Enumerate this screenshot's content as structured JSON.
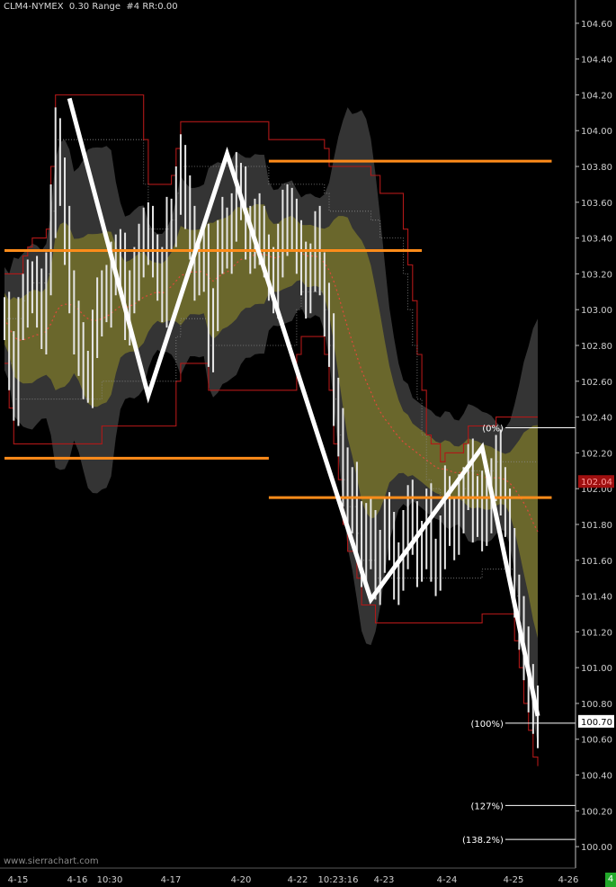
{
  "header": {
    "symbol": "CLM4-NYMEX",
    "bar_period": "0.30 Range",
    "chart_number": "#4",
    "rr": "RR:0.00"
  },
  "watermark": "www.sierrachart.com",
  "corner_badge": "4",
  "colors": {
    "background": "#000000",
    "price_bar": "#e6e6e6",
    "channel_outer": "#b01818",
    "band_outer": "#3a3a3a",
    "band_inner": "#6e6a2c",
    "level_line": "#ff8c1a",
    "zigzag": "#ffffff",
    "last_price_bg": "#ffffff",
    "avg_label_bg": "#a01010"
  },
  "chart_data": {
    "type": "line",
    "y_axis": {
      "ylim": [
        99.88,
        104.73
      ],
      "ticks": [
        "104.60",
        "104.40",
        "104.20",
        "104.00",
        "103.80",
        "103.60",
        "103.40",
        "103.20",
        "103.00",
        "102.80",
        "102.60",
        "102.40",
        "102.20",
        "102.00",
        "101.80",
        "101.60",
        "101.40",
        "101.20",
        "101.00",
        "100.80",
        "100.60",
        "100.40",
        "100.20",
        "100.00"
      ]
    },
    "x_axis": {
      "tick_labels": [
        "4-15",
        "4-16",
        "10:30",
        "4-17",
        "4-20",
        "4-22",
        "10:23:16",
        "4-23",
        "4-24",
        "4-25",
        "4-26"
      ]
    },
    "last_price": "100.70",
    "avg_label": "102.04",
    "levels": [
      {
        "y": 103.83,
        "x0": 57,
        "x1": 118
      },
      {
        "y": 103.33,
        "x0": 0,
        "x1": 90
      },
      {
        "y": 102.17,
        "x0": 0,
        "x1": 57
      },
      {
        "y": 101.95,
        "x0": 57,
        "x1": 118
      }
    ],
    "zigzag": {
      "points": [
        [
          14,
          104.18
        ],
        [
          31,
          102.52
        ],
        [
          48,
          103.87
        ],
        [
          79,
          101.38
        ],
        [
          103,
          102.23
        ],
        [
          115,
          100.73
        ]
      ],
      "fib_labels": [
        {
          "label": "(0%)",
          "value": 102.34
        },
        {
          "label": "(100%)",
          "value": 100.69
        },
        {
          "label": "(127%)",
          "value": 100.23
        },
        {
          "label": "(138.2%)",
          "value": 100.04
        }
      ]
    },
    "series": [
      {
        "values": [
          102.95,
          102.7,
          102.5,
          102.95,
          103.05,
          103.1,
          103.15,
          103.05,
          102.9,
          103.2,
          103.55,
          103.95,
          103.7,
          103.4,
          103.1,
          102.9,
          102.75,
          102.65,
          102.6,
          102.85,
          103.0,
          103.1,
          103.05,
          103.2,
          103.3,
          103.25,
          102.95,
          103.1,
          103.2,
          103.3,
          103.45,
          103.4,
          103.3,
          103.2,
          103.05,
          103.45,
          103.5,
          103.65,
          103.8,
          103.6,
          103.4,
          103.2,
          103.25,
          103.3,
          102.8,
          103.0,
          103.35,
          103.45,
          103.35,
          103.5,
          103.7,
          103.65,
          103.4,
          103.35,
          103.5,
          103.4,
          103.3,
          103.2,
          103.1,
          103.3,
          103.55,
          103.45,
          103.5,
          103.35,
          103.2,
          103.1,
          103.25,
          103.4,
          103.2,
          103.0,
          102.8,
          102.5,
          102.3,
          102.05,
          101.9,
          102.0,
          101.75,
          101.6,
          101.8,
          101.7,
          101.5,
          101.65,
          101.8,
          101.75,
          101.5,
          101.55,
          101.7,
          101.9,
          101.75,
          101.6,
          101.7,
          101.85,
          101.6,
          101.55,
          101.7,
          101.95,
          101.8,
          101.75,
          101.9,
          102.0,
          102.1,
          101.85,
          101.95,
          101.8,
          101.9,
          102.05,
          102.15,
          102.0,
          101.85,
          101.6,
          101.4,
          101.25,
          101.05,
          100.9,
          100.75,
          100.7
        ]
      },
      {
        "values": [
          102.95,
          102.9,
          102.85,
          102.83,
          102.83,
          102.84,
          102.85,
          102.86,
          102.86,
          102.88,
          102.92,
          102.98,
          103.02,
          103.03,
          103.03,
          103.02,
          103.0,
          102.97,
          102.95,
          102.94,
          102.94,
          102.95,
          102.96,
          102.98,
          103.0,
          103.02,
          103.01,
          103.02,
          103.03,
          103.05,
          103.07,
          103.08,
          103.09,
          103.1,
          103.09,
          103.11,
          103.13,
          103.16,
          103.19,
          103.2,
          103.21,
          103.21,
          103.21,
          103.22,
          103.18,
          103.16,
          103.18,
          103.2,
          103.21,
          103.23,
          103.26,
          103.28,
          103.29,
          103.29,
          103.31,
          103.31,
          103.31,
          103.3,
          103.29,
          103.29,
          103.31,
          103.32,
          103.33,
          103.33,
          103.32,
          103.3,
          103.3,
          103.3,
          103.29,
          103.26,
          103.22,
          103.16,
          103.08,
          102.99,
          102.9,
          102.82,
          102.74,
          102.66,
          102.6,
          102.54,
          102.48,
          102.43,
          102.39,
          102.36,
          102.32,
          102.29,
          102.26,
          102.24,
          102.22,
          102.2,
          102.18,
          102.16,
          102.14,
          102.12,
          102.11,
          102.11,
          102.1,
          102.09,
          102.09,
          102.09,
          102.09,
          102.08,
          102.08,
          102.07,
          102.06,
          102.06,
          102.06,
          102.06,
          102.05,
          102.03,
          102.0,
          101.96,
          101.92,
          101.87,
          101.81,
          101.76
        ]
      }
    ]
  }
}
